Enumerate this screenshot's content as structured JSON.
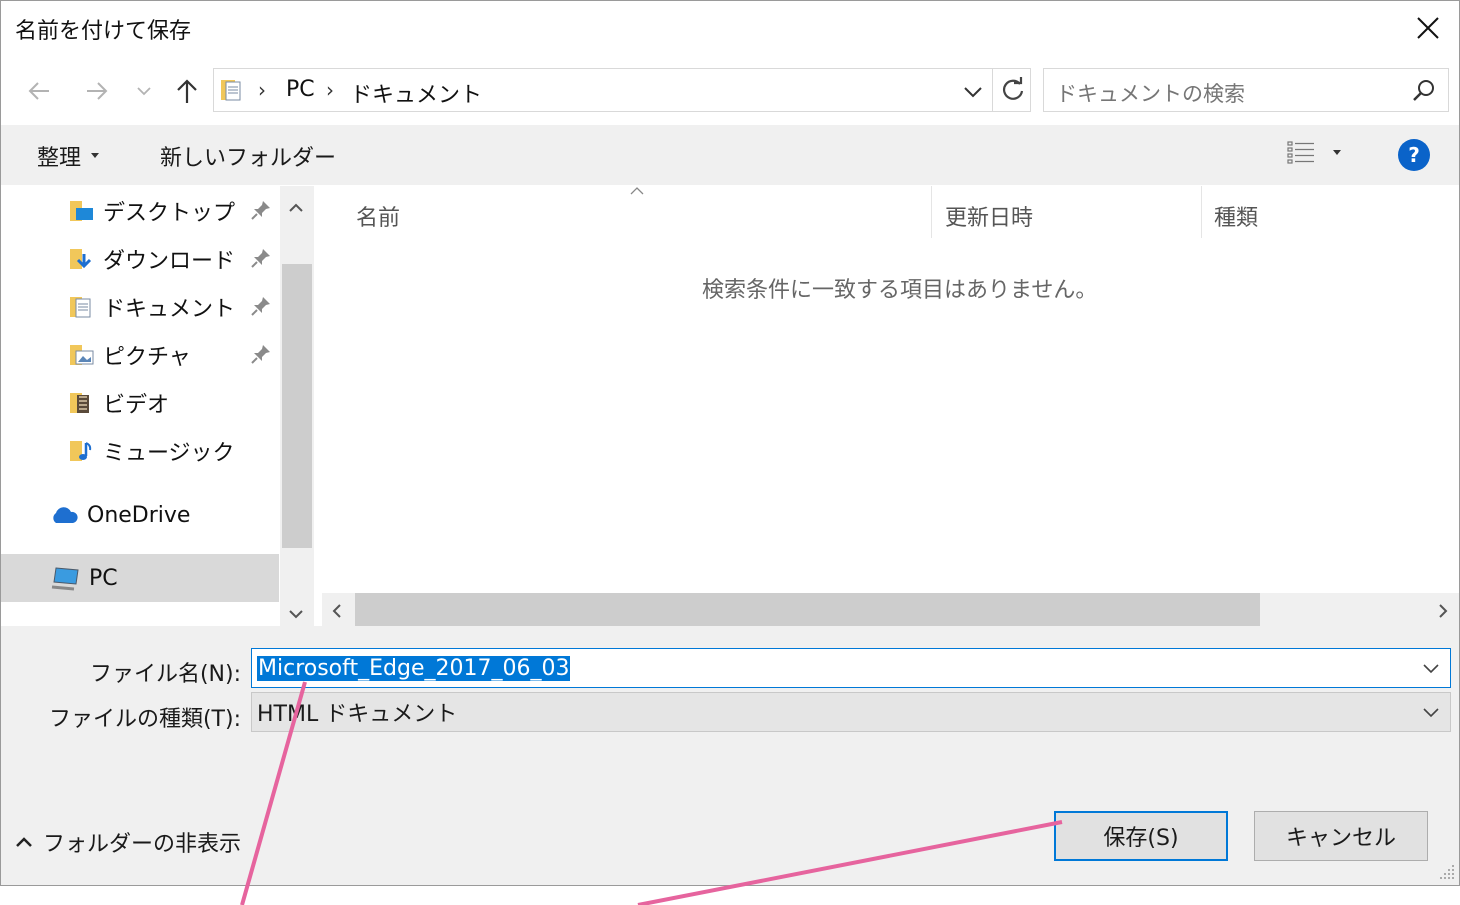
{
  "window": {
    "title": "名前を付けて保存"
  },
  "address_bar": {
    "crumbs": [
      "PC",
      "ドキュメント"
    ]
  },
  "search": {
    "placeholder": "ドキュメントの検索"
  },
  "toolbar": {
    "organize_label": "整理",
    "new_folder_label": "新しいフォルダー"
  },
  "nav_pane": {
    "quick_access": [
      {
        "label": "デスクトップ",
        "pinned": true
      },
      {
        "label": "ダウンロード",
        "pinned": true
      },
      {
        "label": "ドキュメント",
        "pinned": true
      },
      {
        "label": "ピクチャ",
        "pinned": true
      },
      {
        "label": "ビデオ",
        "pinned": false
      },
      {
        "label": "ミュージック",
        "pinned": false
      }
    ],
    "onedrive": "OneDrive",
    "pc": "PC"
  },
  "file_list": {
    "columns": [
      "名前",
      "更新日時",
      "種類"
    ],
    "empty_message": "検索条件に一致する項目はありません。"
  },
  "form": {
    "filename_label": "ファイル名(N):",
    "filename_value": "Microsoft_Edge_2017_06_03",
    "filetype_label": "ファイルの種類(T):",
    "filetype_value": "HTML ドキュメント"
  },
  "buttons": {
    "save": "保存(S)",
    "cancel": "キャンセル"
  },
  "footer": {
    "hide_folders": "フォルダーの非表示"
  },
  "colors": {
    "accent": "#0078d7",
    "annotation_line": "#e6649e",
    "help_icon": "#0a63c9"
  }
}
